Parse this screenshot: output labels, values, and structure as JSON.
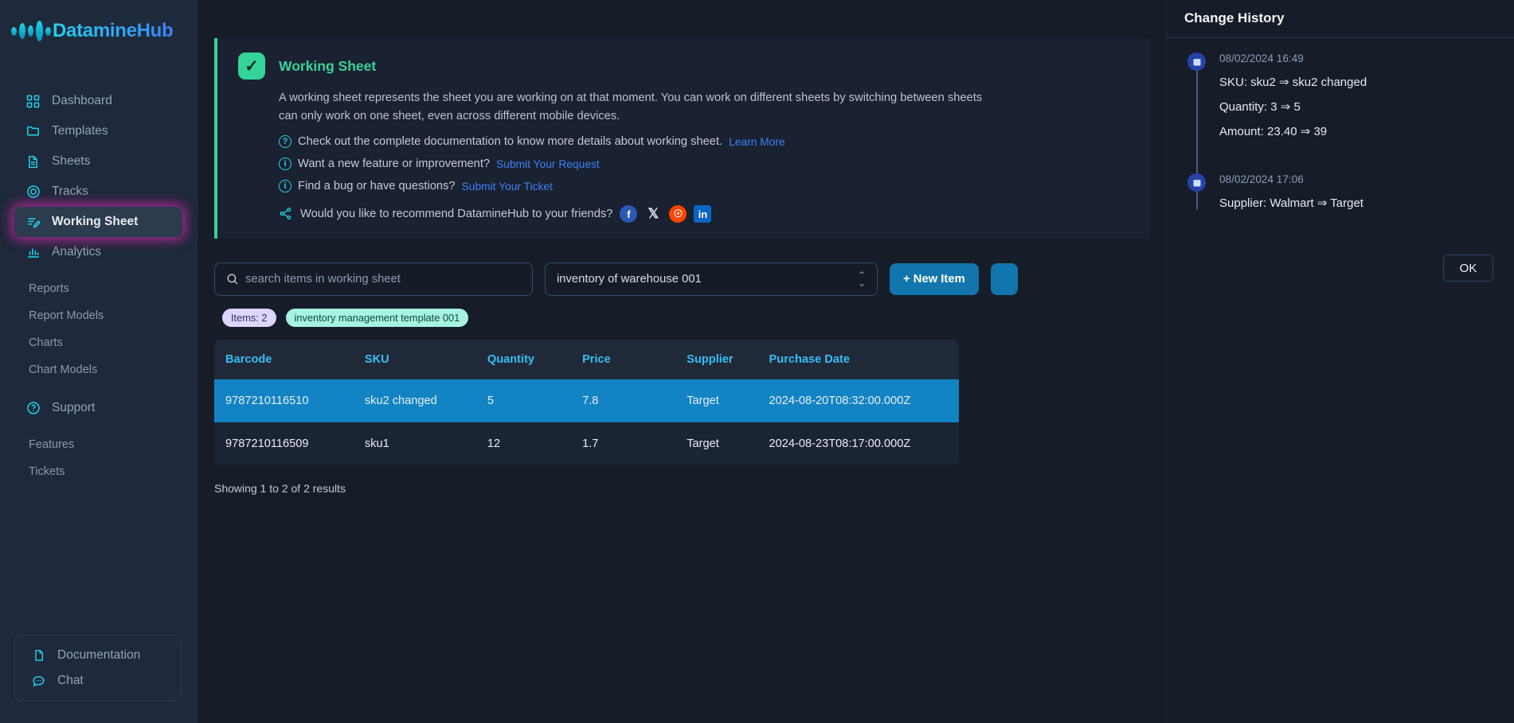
{
  "app": {
    "name": "DatamineHub"
  },
  "sidebar": {
    "main_items": [
      {
        "label": "Dashboard",
        "icon": "grid-icon",
        "active": false
      },
      {
        "label": "Templates",
        "icon": "folder-icon",
        "active": false
      },
      {
        "label": "Sheets",
        "icon": "document-icon",
        "active": false
      },
      {
        "label": "Tracks",
        "icon": "target-icon",
        "active": false
      },
      {
        "label": "Working Sheet",
        "icon": "edit-list-icon",
        "active": true
      },
      {
        "label": "Analytics",
        "icon": "bar-chart-icon",
        "active": false
      }
    ],
    "analytics_subitems": [
      "Reports",
      "Report Models",
      "Charts",
      "Chart Models"
    ],
    "support": {
      "label": "Support",
      "icon": "question-circle-icon"
    },
    "support_subitems": [
      "Features",
      "Tickets"
    ],
    "bottom_items": [
      {
        "label": "Documentation",
        "icon": "file-icon"
      },
      {
        "label": "Chat",
        "icon": "chat-bubble-icon"
      }
    ]
  },
  "banner": {
    "title": "Working Sheet",
    "paragraph": "A working sheet represents the sheet you are working on at that moment. You can work on different sheets by switching between sheets\ncan only work on one sheet, even across different mobile devices.",
    "doc_line": "Check out the complete documentation to know more details about working sheet.",
    "doc_link": "Learn More",
    "feature_line": "Want a new feature or improvement?",
    "feature_link": "Submit Your Request",
    "bug_line": "Find a bug or have questions?",
    "bug_link": "Submit Your Ticket",
    "share_line": "Would you like to recommend DatamineHub to your friends?",
    "socials": [
      "facebook-icon",
      "x-twitter-icon",
      "reddit-icon",
      "linkedin-icon"
    ],
    "accent_color": "#34d399"
  },
  "toolbar": {
    "search_placeholder": "search items in working sheet",
    "search_value": "",
    "sheet_select_value": "inventory of warehouse 001",
    "new_item_label": "+ New Item"
  },
  "badges": {
    "items_count": "Items: 2",
    "template": "inventory management template 001"
  },
  "table": {
    "columns": [
      "Barcode",
      "SKU",
      "Quantity",
      "Price",
      "Supplier",
      "Purchase Date"
    ],
    "rows": [
      {
        "selected": true,
        "cells": [
          "9787210116510",
          "sku2 changed",
          "5",
          "7.8",
          "Target",
          "2024-08-20T08:32:00.000Z"
        ]
      },
      {
        "selected": false,
        "cells": [
          "9787210116509",
          "sku1",
          "12",
          "1.7",
          "Target",
          "2024-08-23T08:17:00.000Z"
        ]
      }
    ],
    "results_text": "Showing 1 to 2 of 2 results",
    "header_color": "#38bdf8",
    "selected_row_color": "#1284c4"
  },
  "change_history": {
    "title": "Change History",
    "entries": [
      {
        "timestamp": "08/02/2024 16:49",
        "changes": [
          "SKU: sku2 ⇒ sku2 changed",
          "Quantity: 3 ⇒ 5",
          "Amount: 23.40 ⇒ 39"
        ]
      },
      {
        "timestamp": "08/02/2024 17:06",
        "changes": [
          "Supplier: Walmart ⇒ Target"
        ]
      }
    ],
    "ok_label": "OK"
  }
}
